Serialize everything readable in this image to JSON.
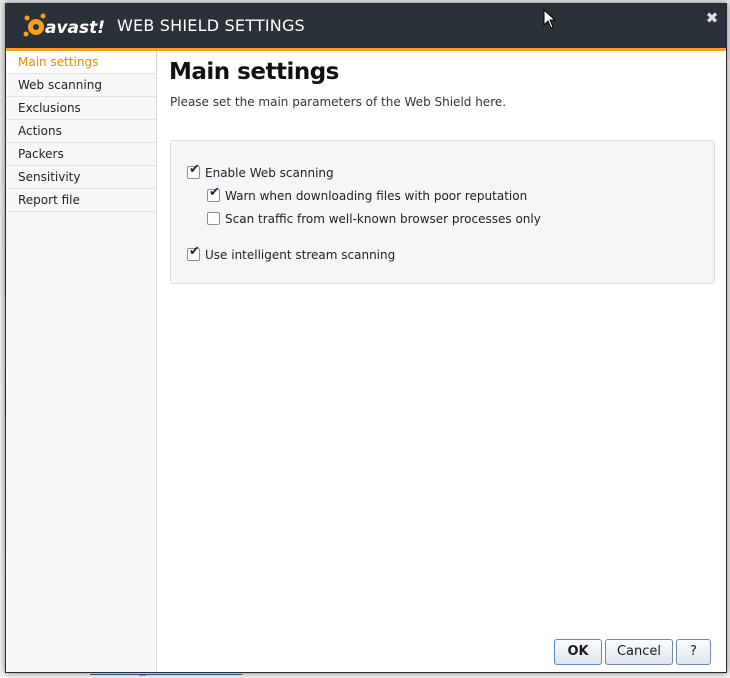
{
  "dialog": {
    "title": "WEB SHIELD SETTINGS",
    "logo_text": "avast!",
    "close_icon": "close-icon"
  },
  "sidebar": {
    "items": [
      {
        "label": "Main settings",
        "active": true
      },
      {
        "label": "Web scanning",
        "active": false
      },
      {
        "label": "Exclusions",
        "active": false
      },
      {
        "label": "Actions",
        "active": false
      },
      {
        "label": "Packers",
        "active": false
      },
      {
        "label": "Sensitivity",
        "active": false
      },
      {
        "label": "Report file",
        "active": false
      }
    ]
  },
  "main": {
    "heading": "Main settings",
    "subtitle": "Please set the main parameters of the Web Shield here.",
    "options": [
      {
        "label": "Enable Web scanning",
        "checked": true
      },
      {
        "label": "Warn when downloading files with poor reputation",
        "checked": true
      },
      {
        "label": "Scan traffic from well-known browser processes only",
        "checked": false
      },
      {
        "label": "Use intelligent stream scanning",
        "checked": true
      }
    ]
  },
  "buttons": {
    "ok": "OK",
    "cancel": "Cancel",
    "help": "?"
  },
  "background": {
    "link_text": "comment_status=moderated"
  },
  "colors": {
    "titlebar": "#2b3139",
    "accent": "#f7a11a",
    "active_nav": "#e08a00"
  }
}
